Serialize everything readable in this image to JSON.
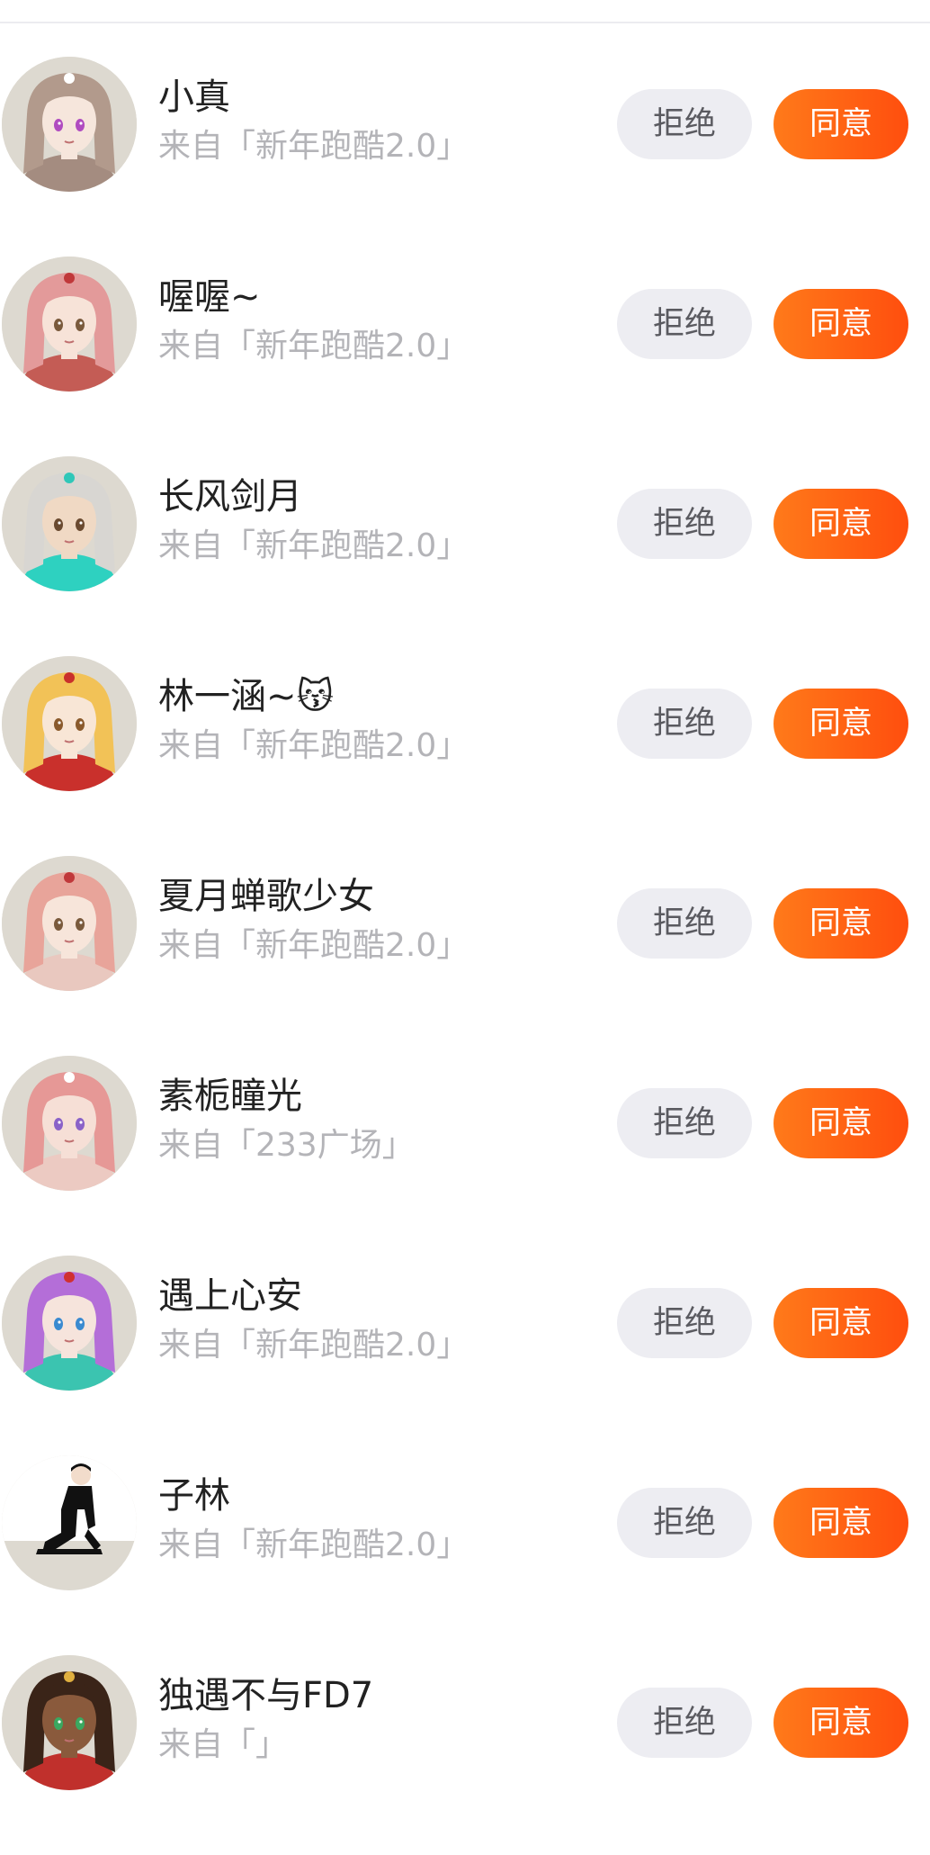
{
  "requests": [
    {
      "nickname": "小真",
      "source": "来自「新年跑酷2.0」",
      "reject_label": "拒绝",
      "accept_label": "同意",
      "avatar": {
        "bg": "#ddd9d0",
        "hair": "#b29a8c",
        "skin": "#f6e6dc",
        "eye": "#b04cc0",
        "accent": "#ffffff",
        "cloth": "#a48c80"
      }
    },
    {
      "nickname": "喔喔~",
      "source": "来自「新年跑酷2.0」",
      "reject_label": "拒绝",
      "accept_label": "同意",
      "avatar": {
        "bg": "#ddd9d0",
        "hair": "#e39a9a",
        "skin": "#f7e3d8",
        "eye": "#7a5a3c",
        "accent": "#c0383a",
        "cloth": "#c45c55"
      }
    },
    {
      "nickname": "长风剑月",
      "source": "来自「新年跑酷2.0」",
      "reject_label": "拒绝",
      "accept_label": "同意",
      "avatar": {
        "bg": "#ddd9d0",
        "hair": "#d8d6d2",
        "skin": "#f0d9c4",
        "eye": "#6a4a30",
        "accent": "#2fc7b8",
        "cloth": "#2ed1c0"
      }
    },
    {
      "nickname": "林一涵~😽",
      "source": "来自「新年跑酷2.0」",
      "reject_label": "拒绝",
      "accept_label": "同意",
      "avatar": {
        "bg": "#ddd9d0",
        "hair": "#f2c257",
        "skin": "#f8e6d6",
        "eye": "#8a5a2c",
        "accent": "#c9302c",
        "cloth": "#c9302c"
      }
    },
    {
      "nickname": "夏月蝉歌少女",
      "source": "来自「新年跑酷2.0」",
      "reject_label": "拒绝",
      "accept_label": "同意",
      "avatar": {
        "bg": "#ddd9d0",
        "hair": "#e8a49a",
        "skin": "#f7e5da",
        "eye": "#7a5a3c",
        "accent": "#c0383a",
        "cloth": "#e9c8bf"
      }
    },
    {
      "nickname": "素栀瞳光",
      "source": "来自「233广场」",
      "reject_label": "拒绝",
      "accept_label": "同意",
      "avatar": {
        "bg": "#ddd9d0",
        "hair": "#e69896",
        "skin": "#f6dfd6",
        "eye": "#8a62c8",
        "accent": "#ffffff",
        "cloth": "#eccac2"
      }
    },
    {
      "nickname": "遇上心安",
      "source": "来自「新年跑酷2.0」",
      "reject_label": "拒绝",
      "accept_label": "同意",
      "avatar": {
        "bg": "#ddd9d0",
        "hair": "#b46ed8",
        "skin": "#f6e4dc",
        "eye": "#3a8ad0",
        "accent": "#d03030",
        "cloth": "#3bc4b0"
      }
    },
    {
      "nickname": "子林",
      "source": "来自「新年跑酷2.0」",
      "reject_label": "拒绝",
      "accept_label": "同意",
      "avatar": {
        "bg": "#ddd9d0",
        "hair": "#111111",
        "skin": "#f2dccb",
        "eye": "#111111",
        "accent": "#111111",
        "cloth": "#111111"
      }
    },
    {
      "nickname": "独遇不与FD7",
      "source": "来自「」",
      "reject_label": "拒绝",
      "accept_label": "同意",
      "avatar": {
        "bg": "#ddd9d0",
        "hair": "#3a2418",
        "skin": "#8a5a3c",
        "eye": "#3aa860",
        "accent": "#e0b040",
        "cloth": "#c0302c"
      }
    }
  ]
}
